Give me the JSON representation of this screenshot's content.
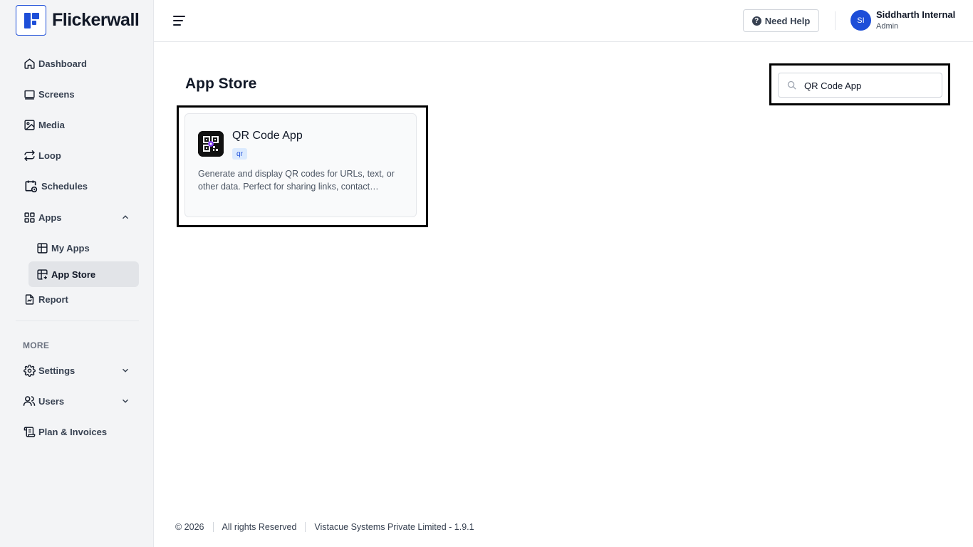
{
  "brand": {
    "name": "Flickerwall"
  },
  "sidebar": {
    "items": [
      {
        "label": "Dashboard"
      },
      {
        "label": "Screens"
      },
      {
        "label": "Media"
      },
      {
        "label": "Loop"
      },
      {
        "label": "Schedules"
      },
      {
        "label": "Apps"
      },
      {
        "label": "My Apps"
      },
      {
        "label": "App Store"
      },
      {
        "label": "Report"
      }
    ],
    "more_label": "MORE",
    "more_items": [
      {
        "label": "Settings"
      },
      {
        "label": "Users"
      },
      {
        "label": "Plan & Invoices"
      }
    ]
  },
  "header": {
    "help_label": "Need Help",
    "avatar_initials": "SI",
    "user_name": "Siddharth Internal",
    "user_role": "Admin"
  },
  "main": {
    "title": "App Store",
    "search": {
      "value": "QR Code App"
    },
    "apps": [
      {
        "name": "QR Code App",
        "tag": "qr",
        "description": "Generate and display QR codes for URLs, text, or other data. Perfect for sharing links, contact information, and more."
      }
    ]
  },
  "footer": {
    "copyright": "© 2026",
    "rights": "All rights Reserved",
    "company": "Vistacue Systems Private Limited - 1.9.1"
  },
  "colors": {
    "accent": "#1d4ed8",
    "sidebar_bg": "#f3f4f6",
    "tag_bg": "#dbeafe"
  }
}
